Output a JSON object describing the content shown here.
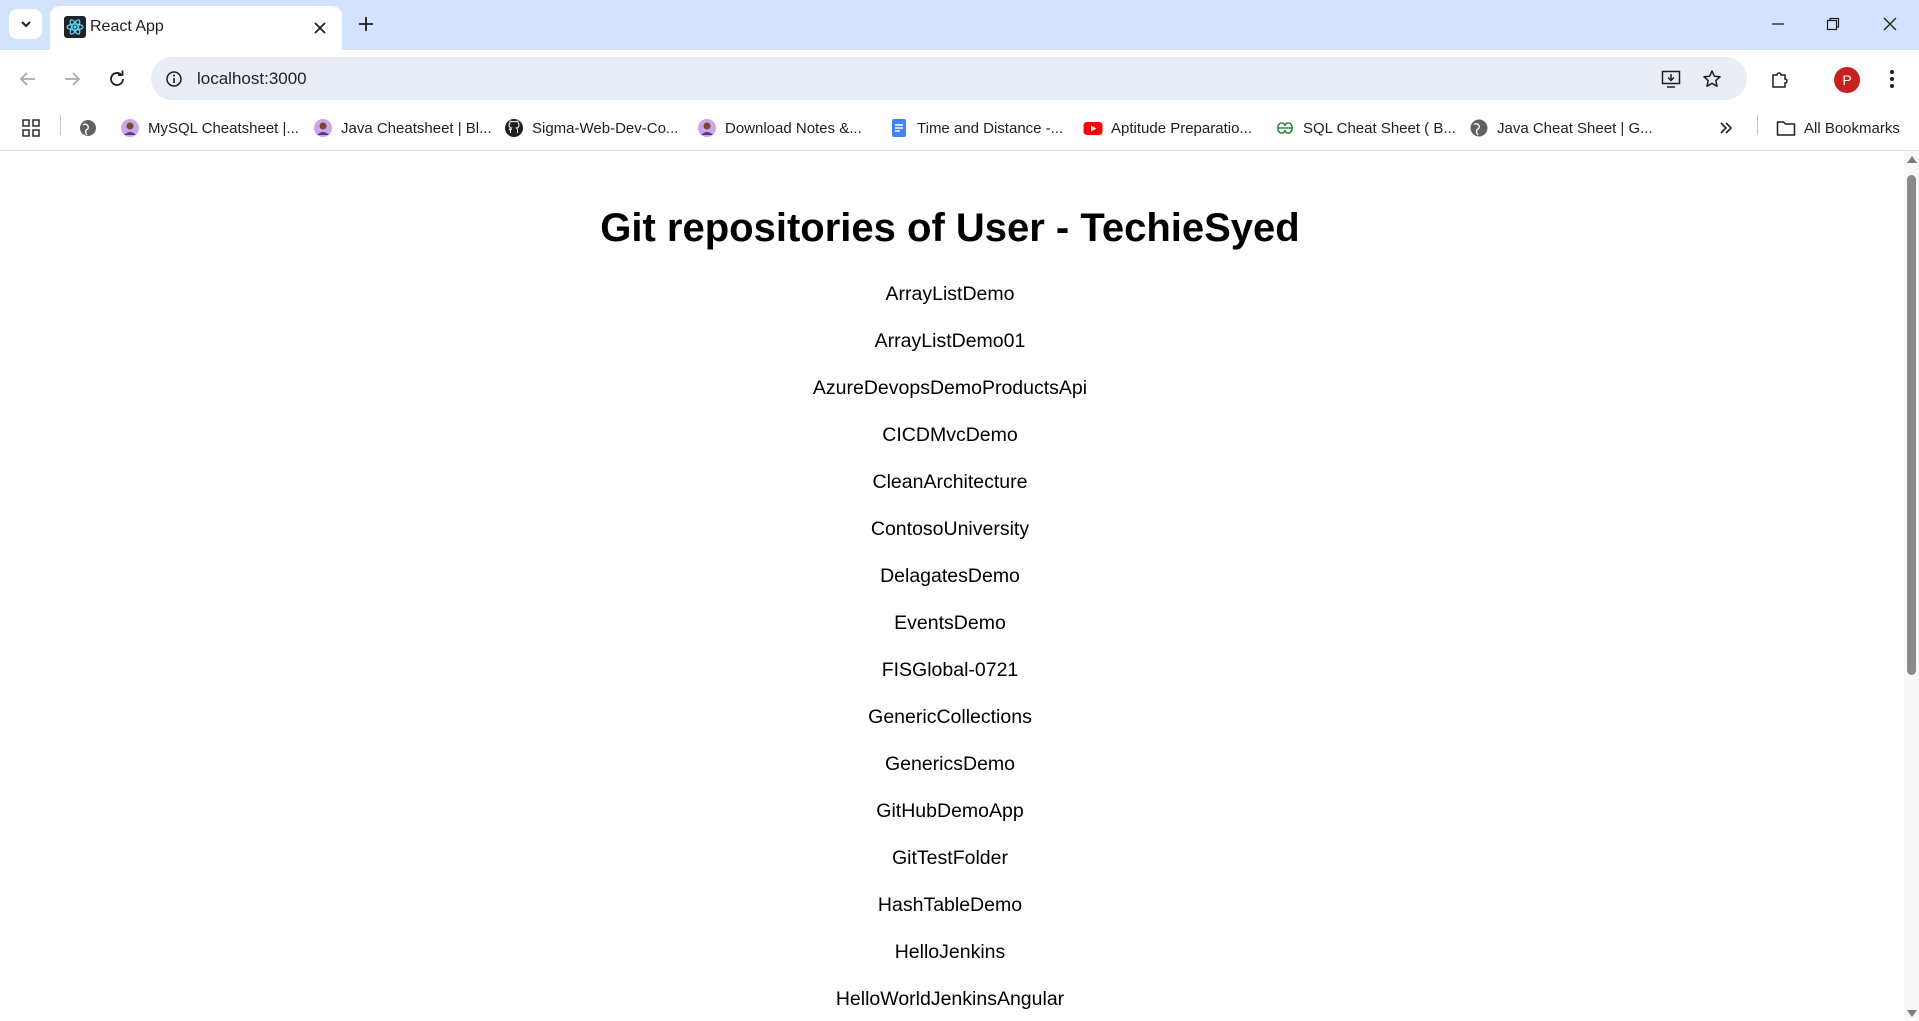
{
  "browser": {
    "tab": {
      "title": "React App"
    },
    "address_bar": {
      "url": "localhost:3000"
    },
    "profile": {
      "initial": "P",
      "color": "#c5221f"
    },
    "bookmarks": [
      {
        "label": "MySQL Cheatsheet |...",
        "icon": "avatar-icon"
      },
      {
        "label": "Java Cheatsheet | Bl...",
        "icon": "avatar-icon"
      },
      {
        "label": "Sigma-Web-Dev-Co...",
        "icon": "github-icon"
      },
      {
        "label": "Download Notes &...",
        "icon": "avatar-icon"
      },
      {
        "label": "Time and Distance -...",
        "icon": "docs-icon"
      },
      {
        "label": "Aptitude Preparatio...",
        "icon": "youtube-icon"
      },
      {
        "label": "SQL Cheat Sheet ( B...",
        "icon": "gfg-icon"
      },
      {
        "label": "Java Cheat Sheet | G...",
        "icon": "globe-icon"
      }
    ],
    "all_bookmarks_label": "All Bookmarks"
  },
  "page": {
    "title": "Git repositories of User - TechieSyed",
    "repos": [
      "ArrayListDemo",
      "ArrayListDemo01",
      "AzureDevopsDemoProductsApi",
      "CICDMvcDemo",
      "CleanArchitecture",
      "ContosoUniversity",
      "DelagatesDemo",
      "EventsDemo",
      "FISGlobal-0721",
      "GenericCollections",
      "GenericsDemo",
      "GitHubDemoApp",
      "GitTestFolder",
      "HashTableDemo",
      "HelloJenkins",
      "HelloWorldJenkinsAngular"
    ]
  },
  "colors": {
    "titlebar": "#d3e3fd",
    "omnibox": "#e9eef6",
    "text": "#000000"
  }
}
